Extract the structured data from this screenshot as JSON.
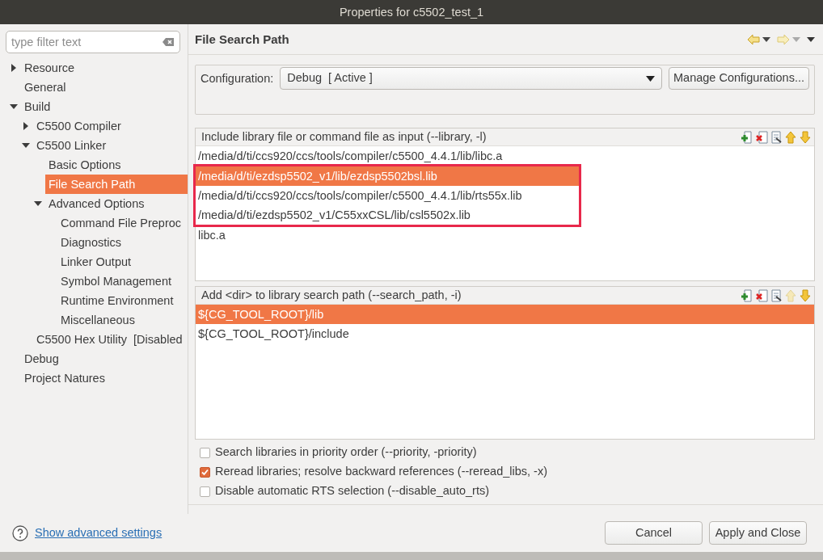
{
  "window": {
    "title": "Properties for c5502_test_1"
  },
  "filter": {
    "placeholder": "type filter text"
  },
  "tree": [
    {
      "label": "Resource",
      "expanded": false,
      "selected": false
    },
    {
      "label": "General",
      "selected": false
    },
    {
      "label": "Build",
      "expanded": true,
      "selected": false,
      "children": [
        {
          "label": "C5500 Compiler",
          "expanded": false,
          "selected": false
        },
        {
          "label": "C5500 Linker",
          "expanded": true,
          "selected": false,
          "children": [
            {
              "label": "Basic Options",
              "selected": false
            },
            {
              "label": "File Search Path",
              "selected": true
            },
            {
              "label": "Advanced Options",
              "expanded": true,
              "selected": false,
              "children": [
                {
                  "label": "Command File Preproc",
                  "selected": false
                },
                {
                  "label": "Diagnostics",
                  "selected": false
                },
                {
                  "label": "Linker Output",
                  "selected": false
                },
                {
                  "label": "Symbol Management",
                  "selected": false
                },
                {
                  "label": "Runtime Environment",
                  "selected": false
                },
                {
                  "label": "Miscellaneous",
                  "selected": false
                }
              ]
            }
          ]
        },
        {
          "label": "C5500 Hex Utility  [Disabled",
          "selected": false
        }
      ]
    },
    {
      "label": "Debug",
      "selected": false
    },
    {
      "label": "Project Natures",
      "selected": false
    }
  ],
  "page": {
    "title": "File Search Path"
  },
  "configuration": {
    "label": "Configuration:",
    "value": "Debug  [ Active ]",
    "button": "Manage Configurations..."
  },
  "lists": [
    {
      "title": "Include library file or command file as input (--library, -l)",
      "up_enabled": true,
      "items": [
        {
          "text": "/media/d/ti/ccs920/ccs/tools/compiler/c5500_4.4.1/lib/libc.a",
          "selected": false,
          "marked": false
        },
        {
          "text": "/media/d/ti/ezdsp5502_v1/lib/ezdsp5502bsl.lib",
          "selected": true,
          "marked": true
        },
        {
          "text": "/media/d/ti/ccs920/ccs/tools/compiler/c5500_4.4.1/lib/rts55x.lib",
          "selected": false,
          "marked": true
        },
        {
          "text": "/media/d/ti/ezdsp5502_v1/C55xxCSL/lib/csl5502x.lib",
          "selected": false,
          "marked": true
        },
        {
          "text": "libc.a",
          "selected": false,
          "marked": false
        }
      ]
    },
    {
      "title": "Add <dir> to library search path (--search_path, -i)",
      "up_enabled": false,
      "items": [
        {
          "text": "${CG_TOOL_ROOT}/lib",
          "selected": true,
          "marked": false
        },
        {
          "text": "${CG_TOOL_ROOT}/include",
          "selected": false,
          "marked": false
        }
      ]
    }
  ],
  "options": [
    {
      "label": "Search libraries in priority order (--priority, -priority)",
      "checked": false
    },
    {
      "label": "Reread libraries; resolve backward references (--reread_libs, -x)",
      "checked": true
    },
    {
      "label": "Disable automatic RTS selection (--disable_auto_rts)",
      "checked": false
    }
  ],
  "footer": {
    "link": "Show advanced settings",
    "buttons": [
      "Cancel",
      "Apply and Close"
    ]
  }
}
